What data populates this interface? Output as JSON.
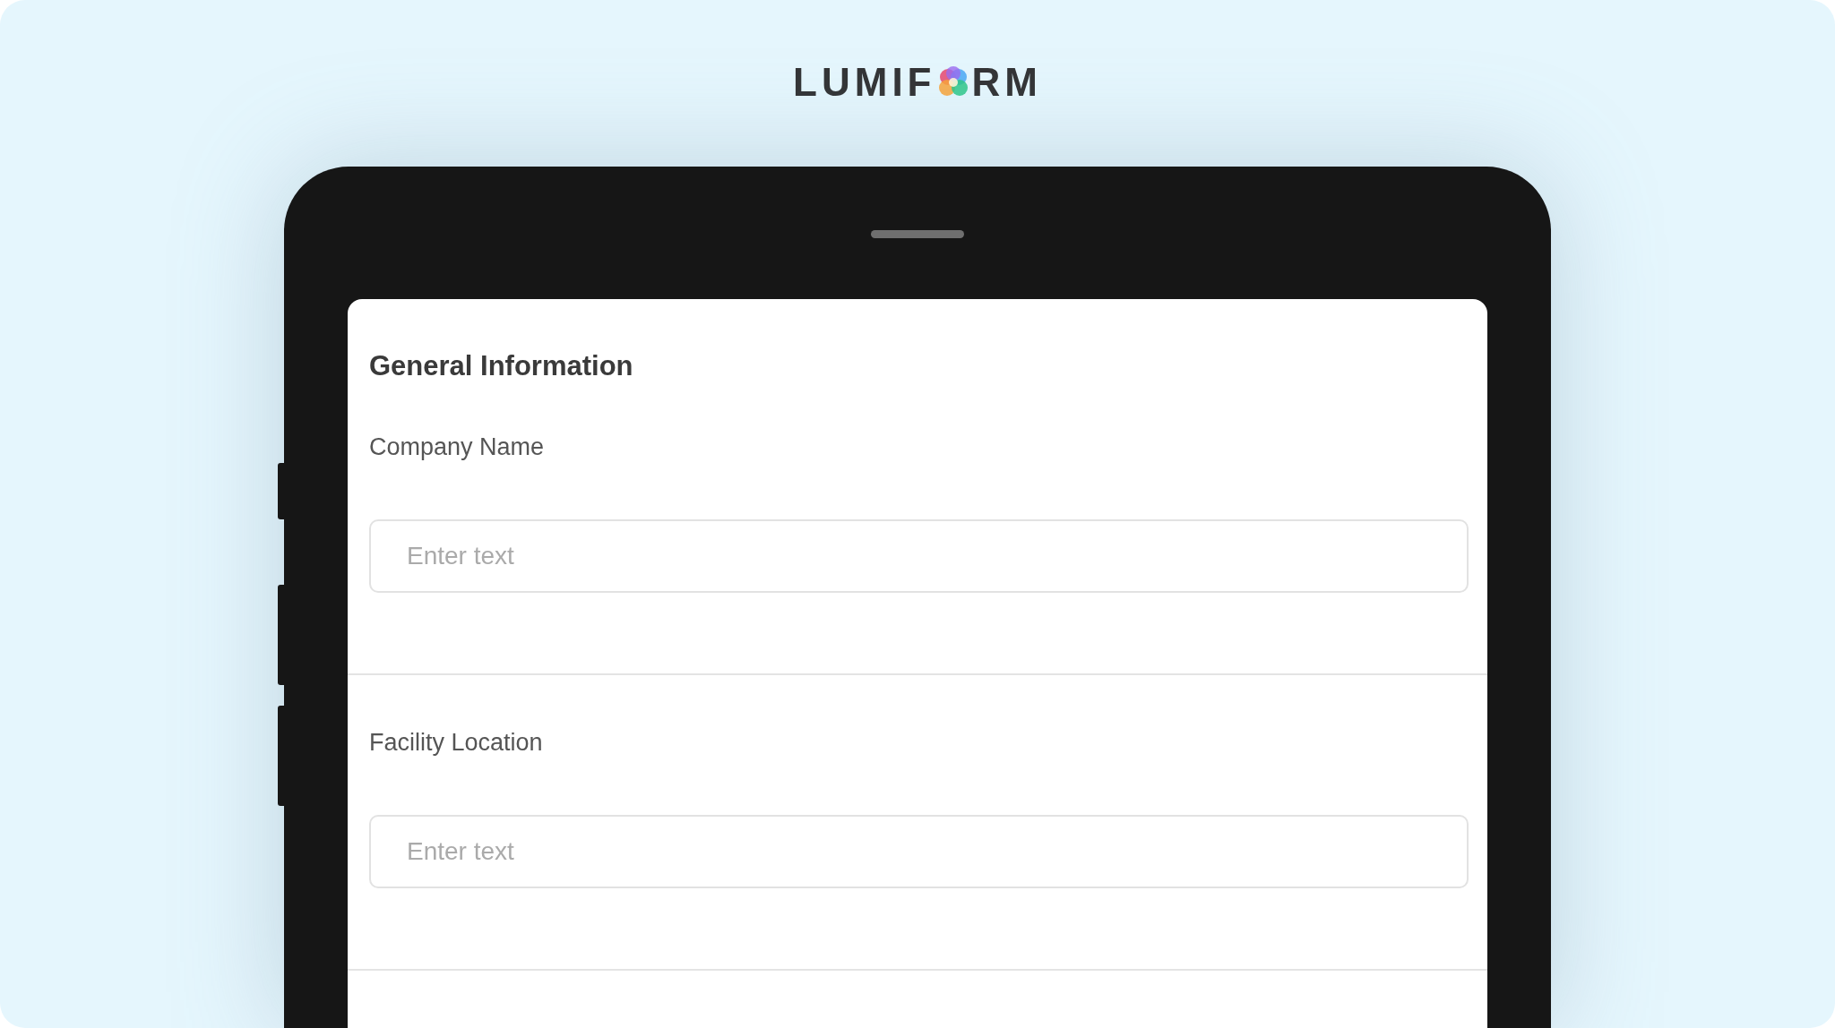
{
  "logo": {
    "text_before": "LUMIF",
    "text_after": "RM"
  },
  "form": {
    "title": "General Information",
    "fields": [
      {
        "label": "Company Name",
        "placeholder": "Enter text"
      },
      {
        "label": "Facility Location",
        "placeholder": "Enter text"
      }
    ]
  }
}
